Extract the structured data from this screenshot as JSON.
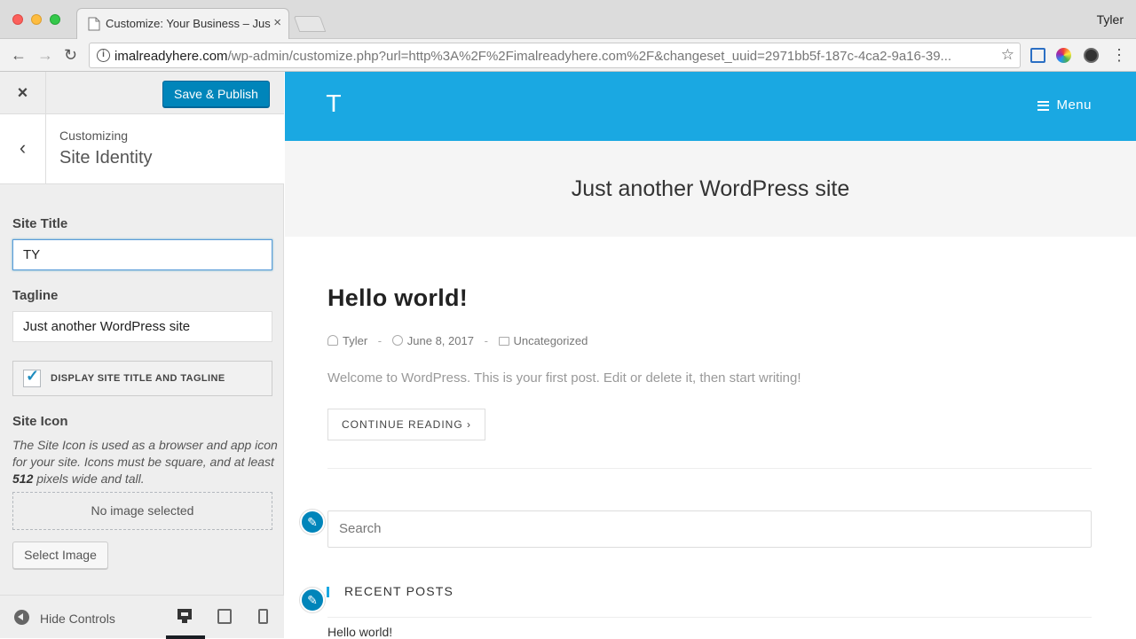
{
  "browser": {
    "tab_title": "Customize: Your Business – Just another WordPress site",
    "tab_close": "×",
    "profile_name": "Tyler",
    "url_host": "imalreadyhere.com",
    "url_path": "/wp-admin/customize.php?url=http%3A%2F%2Fimalreadyhere.com%2F&changeset_uuid=2971bb5f-187c-4ca2-9a16-39...",
    "nav_back": "←",
    "nav_forward": "→",
    "nav_reload": "↻",
    "star": "☆",
    "menu": "⋮",
    "icons": [
      "favicon-icon",
      "info-icon",
      "star-icon",
      "cast-icon",
      "color-picker-icon",
      "dark-reader-icon",
      "chrome-menu-icon"
    ]
  },
  "sidebar": {
    "close_glyph": "×",
    "publish_label": "Save & Publish",
    "back_glyph": "‹",
    "breadcrumb": "Customizing",
    "section_title": "Site Identity",
    "site_title_label": "Site Title",
    "site_title_value": "TY",
    "tagline_label": "Tagline",
    "tagline_value": "Just another WordPress site",
    "display_checkbox_label": "DISPLAY SITE TITLE AND TAGLINE",
    "display_checked": true,
    "check_glyph": "✓",
    "site_icon_label": "Site Icon",
    "site_icon_desc_before": "The Site Icon is used as a browser and app icon for your site. Icons must be square, and at least ",
    "site_icon_desc_bold": "512",
    "site_icon_desc_after": " pixels wide and tall.",
    "no_image": "No image selected",
    "select_image": "Select Image",
    "hide_controls": "Hide Controls",
    "devices": [
      "desktop",
      "tablet",
      "mobile"
    ],
    "active_device": "desktop"
  },
  "preview": {
    "site_logo": "T",
    "menu_label": "Menu",
    "tagline": "Just another WordPress site",
    "post_title": "Hello world!",
    "post_author": "Tyler",
    "post_date": "June 8, 2017",
    "post_category": "Uncategorized",
    "meta_sep": "-",
    "post_excerpt": "Welcome to WordPress. This is your first post. Edit or delete it, then start writing!",
    "continue_label": "CONTINUE READING",
    "continue_glyph": "›",
    "search_placeholder": "Search",
    "recent_posts_title": "RECENT POSTS",
    "recent_post_1": "Hello world!",
    "pencil_glyph": "✎",
    "header_color": "#1aa8e2"
  },
  "colors": {
    "wp_blue": "#0085ba",
    "header_blue": "#1aa8e2"
  }
}
